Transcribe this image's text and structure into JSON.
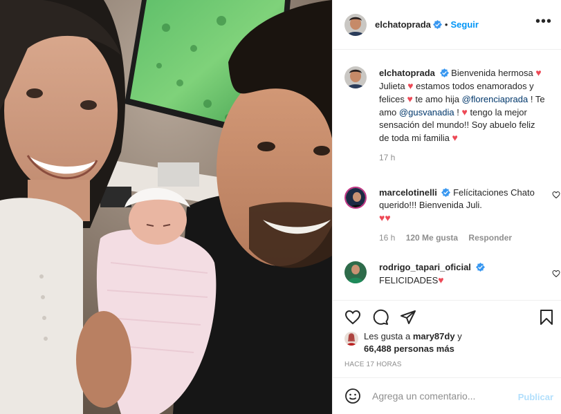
{
  "post": {
    "author": "elchatoprada",
    "follow_label": "Seguir",
    "separator": "•"
  },
  "caption": {
    "username": "elchatoprada",
    "parts": {
      "p1": "Bienvenida hermosa",
      "p2": "Julieta",
      "p3": "estamos todos enamorados y felices",
      "p4": "te amo hija",
      "mention1": "@florenciaprada",
      "p5": "! Te amo",
      "mention2": "@gusvanadia",
      "p6": "!",
      "p7": "tengo la mejor sensación del mundo!! Soy abuelo feliz de toda mi familia"
    },
    "time": "17 h"
  },
  "comments": [
    {
      "username": "marcelotinelli",
      "text": "Felícitaciones Chato querido!!! Bienvenida Juli.",
      "time": "16 h",
      "likes": "120 Me gusta",
      "reply": "Responder"
    },
    {
      "username": "rodrigo_tapari_oficial",
      "text": "FELICIDADES"
    }
  ],
  "likes": {
    "prefix": "Les gusta a",
    "user": "mary87dy",
    "conj": "y",
    "count": "66,488 personas más"
  },
  "timestamp": "HACE 17 HORAS",
  "comment_box": {
    "placeholder": "Agrega un comentario...",
    "publish_label": "Publicar"
  },
  "icons": {
    "like": "heart-icon",
    "comment": "comment-icon",
    "share": "paper-plane-icon",
    "save": "bookmark-icon",
    "emoji": "smiley-icon",
    "verified": "verified-badge-icon",
    "more": "more-options-icon"
  },
  "colors": {
    "link": "#0095f6",
    "mention": "#00376b",
    "heart": "#ed4956",
    "muted": "#8e8e8e",
    "publish_disabled": "#b2dffc"
  }
}
